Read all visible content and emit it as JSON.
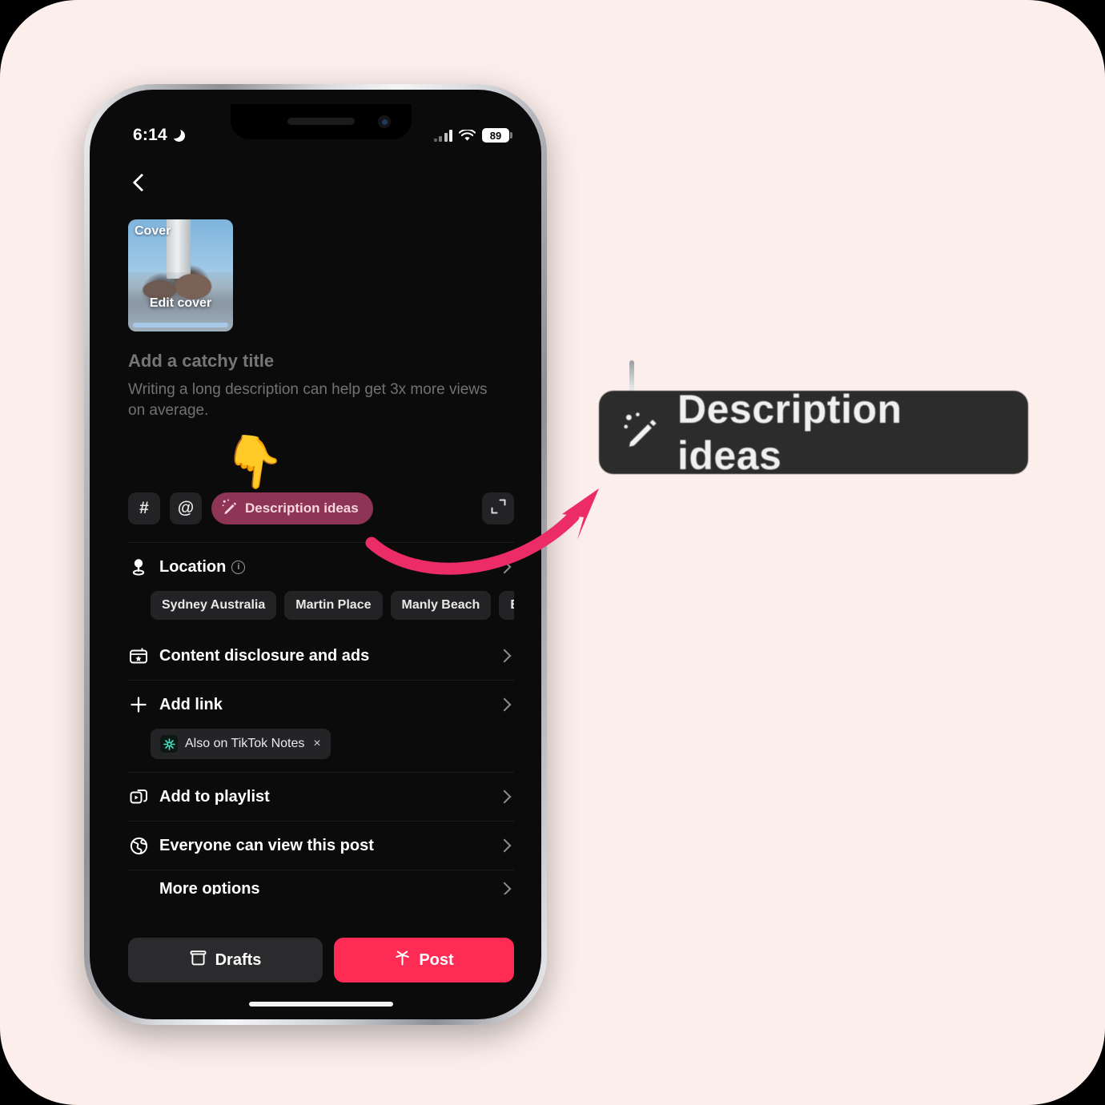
{
  "theme": {
    "page_background": "#FCEEEA",
    "screen_background": "#0b0b0c",
    "accent_red": "#FE2C55",
    "chip_maroon": "#8e3454",
    "arrow_pink": "#EC2C67",
    "notes_teal": "#3ee6c4"
  },
  "status_bar": {
    "time": "6:14",
    "moon_icon": "crescent-moon-icon",
    "signal_icon": "cellular-signal-icon",
    "wifi_icon": "wifi-icon",
    "battery_level": "89"
  },
  "nav": {
    "back_icon": "chevron-left-icon"
  },
  "cover": {
    "label": "Cover",
    "edit_label": "Edit cover"
  },
  "composer": {
    "title_placeholder": "Add a catchy title",
    "description_hint": "Writing a long description can help get 3x more views on average.",
    "pointer_emoji": "👇",
    "toolbar": {
      "hashtag_label": "#",
      "mention_label": "@",
      "description_ideas_label": "Description ideas",
      "description_ideas_icon": "magic-wand-pencil-icon",
      "expand_icon": "expand-icon"
    }
  },
  "settings": {
    "rows": [
      {
        "id": "location",
        "icon": "location-pin-icon",
        "label": "Location",
        "has_info": true,
        "info_glyph": "i",
        "chevron": "chevron-right-icon"
      },
      {
        "id": "content-disclosure",
        "icon": "content-disclosure-icon",
        "label": "Content disclosure and ads",
        "has_info": false,
        "chevron": "chevron-right-icon"
      },
      {
        "id": "add-link",
        "icon": "plus-icon",
        "label": "Add link",
        "has_info": false,
        "chevron": "chevron-right-icon"
      },
      {
        "id": "add-to-playlist",
        "icon": "playlist-icon",
        "label": "Add to playlist",
        "has_info": false,
        "chevron": "chevron-right-icon"
      },
      {
        "id": "privacy",
        "icon": "globe-icon",
        "label": "Everyone can view this post",
        "has_info": false,
        "chevron": "chevron-right-icon"
      }
    ],
    "more_options_label": "More options",
    "location_chips": [
      "Sydney Australia",
      "Martin Place",
      "Manly Beach",
      "Bondi Bea"
    ],
    "notes_chip": {
      "icon": "tiktok-notes-icon",
      "label": "Also on TikTok Notes",
      "remove_icon": "close-icon",
      "remove_glyph": "×"
    }
  },
  "bottom_bar": {
    "drafts_label": "Drafts",
    "drafts_icon": "drafts-box-icon",
    "post_label": "Post",
    "post_icon": "post-sparkle-icon"
  },
  "callout": {
    "icon": "magic-wand-pencil-icon",
    "label": "Description ideas"
  }
}
